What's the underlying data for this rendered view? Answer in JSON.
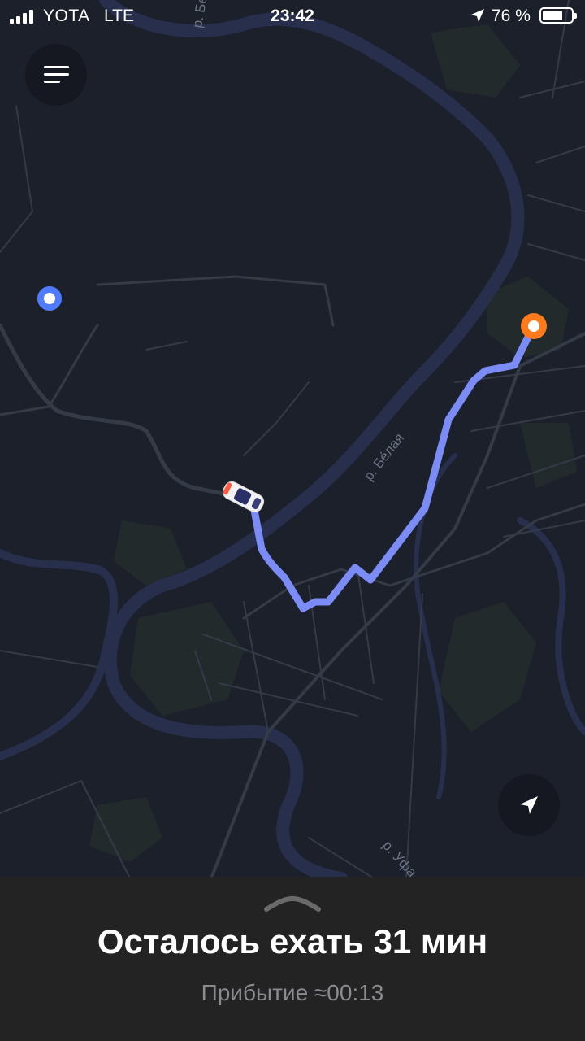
{
  "status_bar": {
    "carrier": "YOTA",
    "network": "LTE",
    "time": "23:42",
    "battery": "76 %",
    "battery_level": 0.76
  },
  "map": {
    "river_labels": [
      "р. Бе",
      "р. Бе́лая",
      "р. Уфа"
    ],
    "colors": {
      "background": "#1c202b",
      "route": "#7b8cf7",
      "river": "#272f4d",
      "road": "#353a47",
      "origin_marker": "#4f7cff",
      "destination_marker": "#ff7a1a"
    }
  },
  "buttons": {
    "menu_icon": "hamburger-menu-icon",
    "locate_icon": "navigation-arrow-icon"
  },
  "trip": {
    "remaining": "Осталось ехать 31 мин",
    "arrival": "Прибытие ≈00:13"
  }
}
